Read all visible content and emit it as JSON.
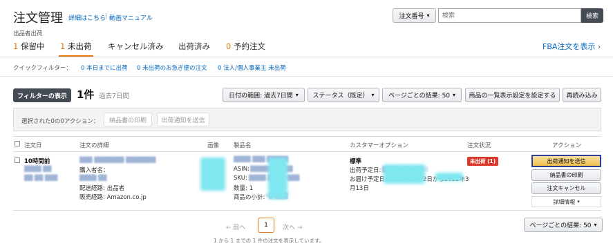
{
  "header": {
    "title": "注文管理",
    "link_details": "詳細はこちら",
    "link_video": "動画マニュアル",
    "subtitle": "出品者出荷",
    "search_select": "注文番号",
    "search_placeholder": "検索",
    "search_button": "検索"
  },
  "tabs": [
    {
      "count": "1",
      "label": "保留中"
    },
    {
      "count": "1",
      "label": "未出荷"
    },
    {
      "count": "",
      "label": "キャンセル済み"
    },
    {
      "count": "",
      "label": "出荷済み"
    },
    {
      "count": "0",
      "label": "予約注文"
    }
  ],
  "fba_link": "FBA注文を表示",
  "quick_filter": {
    "label": "クイックフィルター：",
    "items": [
      {
        "count": "0",
        "label": "本日までに出荷"
      },
      {
        "count": "0",
        "label": "未出荷のお急ぎ便の注文"
      },
      {
        "count": "0",
        "label": "法人/個人事業主 未出荷"
      }
    ]
  },
  "toolbar": {
    "filter_button": "フィルターの表示",
    "count": "1件",
    "period": "過去7日間",
    "date_range": "日付の範囲: 過去7日間",
    "status": "ステータス（既定）",
    "per_page": "ページごとの結果: 50",
    "display_settings": "商品の一覧表示設定を設定する",
    "reload": "再読み込み"
  },
  "bulk": {
    "label": "選択された0の0アクション：",
    "print": "納品書の印刷",
    "ship": "出荷通知を送信"
  },
  "table": {
    "headers": [
      "注文日",
      "注文の詳細",
      "画像",
      "製品名",
      "カスタマーオプション",
      "注文状況",
      "アクション"
    ],
    "row": {
      "order_date": "10時間前",
      "buyer_label": "購入者名：",
      "ship_service": "配送経路: 出品者",
      "channel": "販売経路: Amazon.co.jp",
      "asin_label": "ASIN:",
      "sku_label": "SKU:",
      "quantity": "数量: 1",
      "subtotal_label": "商品の小計:",
      "shipping_type": "標準",
      "ship_by_label": "出荷予定日:",
      "deliver_by": "お届け予定日: 2022年3月12日から2022年3",
      "deliver_by_end": "月13日",
      "status_badge": "未出荷 (1)",
      "action_ship": "出荷通知を送信",
      "action_print": "納品書の印刷",
      "action_cancel": "注文キャンセル",
      "action_details": "詳細情報"
    }
  },
  "pagination": {
    "prev": "前へ",
    "current": "1",
    "next": "次へ",
    "per_page": "ページごとの結果: 50",
    "summary": "1 から 1 までの 1 件の注文を表示しています。"
  },
  "colors": {
    "accent_orange": "#e47911",
    "link_blue": "#0066c0",
    "status_red": "#d9372a",
    "dark_button": "#444b54",
    "highlight_border": "#2c3e9a"
  }
}
